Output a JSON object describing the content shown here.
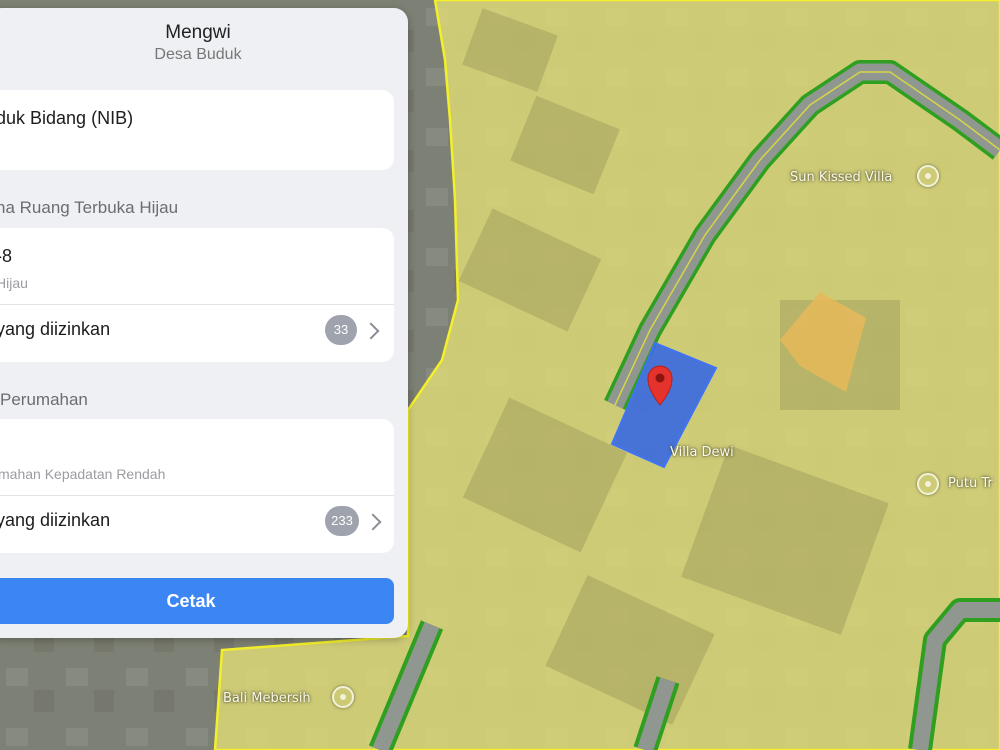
{
  "header": {
    "title": "Mengwi",
    "subtitle": "Desa Buduk"
  },
  "parcel_card": {
    "label": "duk Bidang (NIB)"
  },
  "rth_section": {
    "heading": "na Ruang Terbuka Hijau",
    "zone_code": "-8",
    "zone_name": "Hijau",
    "allowed_label": "yang diizinkan",
    "allowed_count": "33"
  },
  "housing_section": {
    "heading": "Perumahan",
    "zone_name": "mahan Kepadatan Rendah",
    "allowed_label": "yang diizinkan",
    "allowed_count": "233"
  },
  "print_button": {
    "label": "Cetak"
  },
  "map": {
    "pois": [
      {
        "name": "Sun Kissed Villa"
      },
      {
        "name": "Villa Dewi"
      },
      {
        "name": "Putu Tr"
      },
      {
        "name": "Bali Mebersih"
      }
    ],
    "zone_color": "#e1dc78",
    "zone_border": "#f3ef2a",
    "road_color": "#8f9790",
    "road_border": "#2f9f1f",
    "parcel_color": "#2f63e6",
    "marker_color": "#e5322c"
  }
}
